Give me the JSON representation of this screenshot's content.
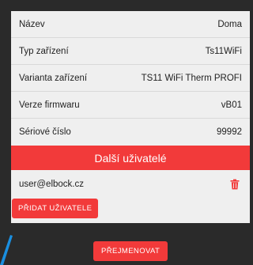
{
  "device": {
    "rows": [
      {
        "label": "Název",
        "value": "Doma"
      },
      {
        "label": "Typ zařízení",
        "value": "Ts11WiFi"
      },
      {
        "label": "Varianta zařízení",
        "value": "TS11 WiFi Therm PROFI"
      },
      {
        "label": "Verze firmwaru",
        "value": "vB01"
      },
      {
        "label": "Sériové číslo",
        "value": "99992"
      }
    ]
  },
  "users": {
    "header": "Další uživatelé",
    "items": [
      {
        "email": "user@elbock.cz",
        "action_icon": "trash-icon"
      }
    ],
    "add_label": "PŘIDAT UŽIVATELE"
  },
  "actions": {
    "rename_label": "PŘEJMENOVAT"
  },
  "colors": {
    "accent": "#f23a3a",
    "background": "#2a2a2a",
    "card": "#efefef",
    "cursor": "#1a8fe0"
  }
}
